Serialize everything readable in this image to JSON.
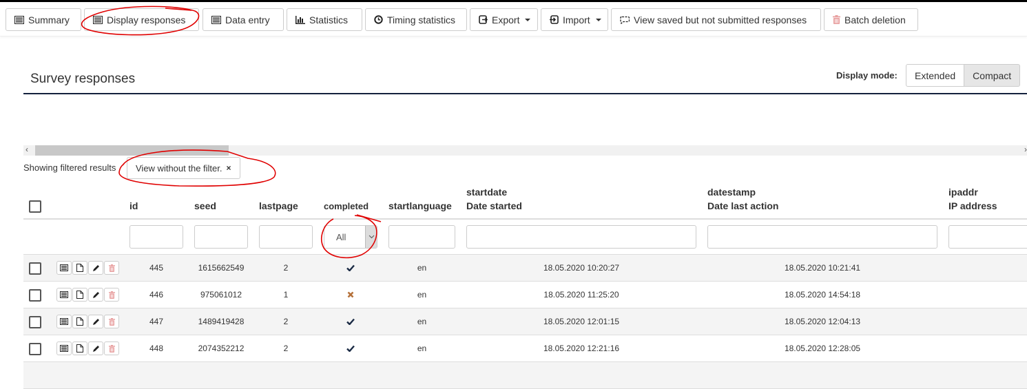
{
  "toolbar": {
    "buttons": [
      {
        "label": "Summary",
        "icon": "list-icon"
      },
      {
        "label": "Display responses",
        "icon": "list-icon"
      },
      {
        "label": "Data entry",
        "icon": "list-icon"
      },
      {
        "label": "Statistics",
        "icon": "bar-chart-icon"
      },
      {
        "label": "Timing statistics",
        "icon": "clock-icon"
      },
      {
        "label": "Export",
        "icon": "export-icon",
        "dropdown": true
      },
      {
        "label": "Import",
        "icon": "import-icon",
        "dropdown": true
      },
      {
        "label": "View saved but not submitted responses",
        "icon": "comment-icon"
      },
      {
        "label": "Batch deletion",
        "icon": "trash-icon"
      }
    ]
  },
  "page": {
    "title": "Survey responses",
    "display_mode_label": "Display mode:",
    "display_modes": [
      "Extended",
      "Compact"
    ],
    "display_mode_selected": "Compact"
  },
  "filter": {
    "status_text": "Showing filtered results",
    "clear_label": "View without the filter.",
    "clear_icon": "×"
  },
  "table": {
    "columns": {
      "id": {
        "name": "id"
      },
      "seed": {
        "name": "seed"
      },
      "lastpage": {
        "name": "lastpage"
      },
      "completed": {
        "name": "completed"
      },
      "startlanguage": {
        "name": "startlanguage"
      },
      "startdate": {
        "name": "startdate",
        "label": "Date started"
      },
      "datestamp": {
        "name": "datestamp",
        "label": "Date last action"
      },
      "ipaddr": {
        "name": "ipaddr",
        "label": "IP address"
      }
    },
    "completed_filter": {
      "selected": "All"
    },
    "rows": [
      {
        "id": "445",
        "seed": "1615662549",
        "lastpage": "2",
        "completed": true,
        "startlanguage": "en",
        "startdate": "18.05.2020 10:20:27",
        "datestamp": "18.05.2020 10:21:41",
        "ipaddr": ""
      },
      {
        "id": "446",
        "seed": "975061012",
        "lastpage": "1",
        "completed": false,
        "startlanguage": "en",
        "startdate": "18.05.2020 11:25:20",
        "datestamp": "18.05.2020 14:54:18",
        "ipaddr": ""
      },
      {
        "id": "447",
        "seed": "1489419428",
        "lastpage": "2",
        "completed": true,
        "startlanguage": "en",
        "startdate": "18.05.2020 12:01:15",
        "datestamp": "18.05.2020 12:04:13",
        "ipaddr": ""
      },
      {
        "id": "448",
        "seed": "2074352212",
        "lastpage": "2",
        "completed": true,
        "startlanguage": "en",
        "startdate": "18.05.2020 12:21:16",
        "datestamp": "18.05.2020 12:28:05",
        "ipaddr": ""
      }
    ]
  },
  "colors": {
    "check": "#1a2a44",
    "cross": "#b5713a",
    "delete_disabled": "#e8a0a0",
    "annotation": "#e00000"
  }
}
